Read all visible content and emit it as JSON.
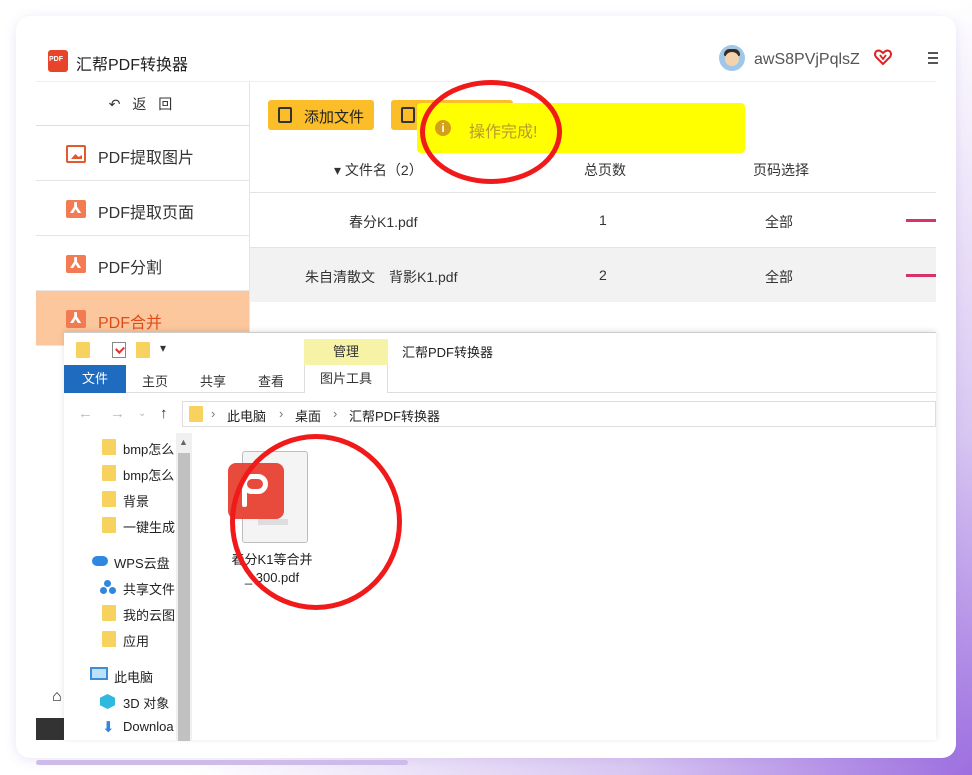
{
  "app": {
    "title": "汇帮PDF转换器",
    "logo_text": "PDF",
    "username": "awS8PVjPqlsZ",
    "accent_color": "#fbbd28",
    "active_color": "#fcc79c"
  },
  "sidebar": {
    "back_label": "返 回",
    "items": [
      {
        "label": "PDF提取图片",
        "icon": "image-icon"
      },
      {
        "label": "PDF提取页面",
        "icon": "pdf-icon"
      },
      {
        "label": "PDF分割",
        "icon": "pdf-icon"
      },
      {
        "label": "PDF合并",
        "icon": "pdf-icon",
        "active": true
      }
    ]
  },
  "toolbar": {
    "add_file_label": "添加文件"
  },
  "toast": {
    "message": "操作完成!"
  },
  "table": {
    "headers": {
      "filename": "▾ 文件名（2）",
      "pages": "总页数",
      "range": "页码选择"
    },
    "rows": [
      {
        "name": "春分K1.pdf",
        "pages": "1",
        "range": "全部"
      },
      {
        "name": "朱自清散文　背影K1.pdf",
        "pages": "2",
        "range": "全部"
      }
    ]
  },
  "explorer": {
    "title": "汇帮PDF转换器",
    "manage_tab": "管理",
    "ribbon_tabs": [
      "文件",
      "主页",
      "共享",
      "查看",
      "图片工具"
    ],
    "breadcrumb": [
      "此电脑",
      "桌面",
      "汇帮PDF转换器"
    ],
    "nav_items": [
      "bmp怎么",
      "bmp怎么",
      "背景",
      "一键生成",
      "WPS云盘",
      "共享文件",
      "我的云图",
      "应用",
      "此电脑",
      "3D 对象",
      "Downloa"
    ],
    "file": {
      "name_line1": "春分K1等合并",
      "name_line2": "_ 300.pdf"
    }
  }
}
